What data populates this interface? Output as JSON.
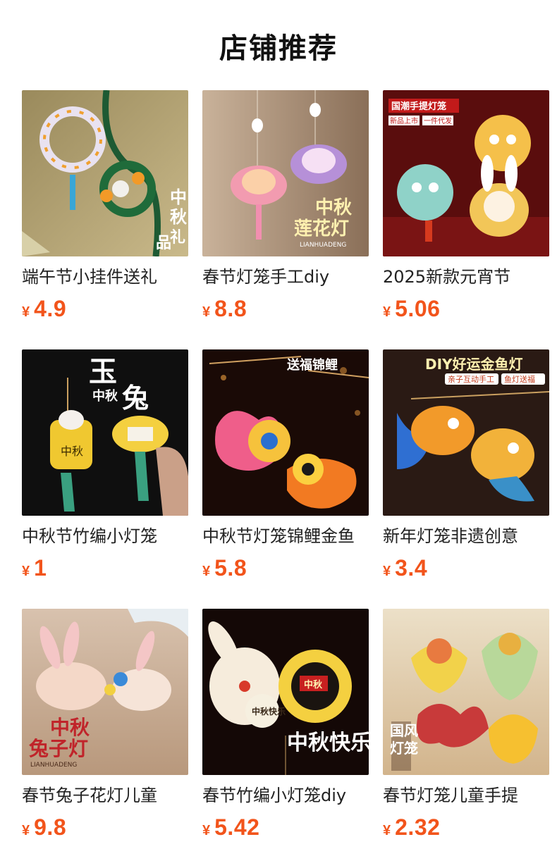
{
  "header": {
    "title": "店铺推荐"
  },
  "currency_symbol": "¥",
  "products": [
    {
      "name": "端午节小挂件送礼",
      "price": "4.9",
      "image_text": [
        "中秋礼品"
      ]
    },
    {
      "name": "春节灯笼手工diy",
      "price": "8.8",
      "image_text": [
        "中秋",
        "莲花灯",
        "LIANHUADENG"
      ]
    },
    {
      "name": "2025新款元宵节",
      "price": "5.06",
      "image_text": [
        "国潮手提灯笼",
        "新品上市",
        "一件代发"
      ]
    },
    {
      "name": "中秋节竹编小灯笼",
      "price": "1",
      "image_text": [
        "玉",
        "中秋",
        "兔"
      ]
    },
    {
      "name": "中秋节灯笼锦鲤金鱼",
      "price": "5.8",
      "image_text": [
        "送福锦鲤"
      ]
    },
    {
      "name": "新年灯笼非遗创意",
      "price": "3.4",
      "image_text": [
        "DIY好运金鱼灯",
        "亲子互动手工",
        "鱼灯送福"
      ]
    },
    {
      "name": "春节兔子花灯儿童",
      "price": "9.8",
      "image_text": [
        "中秋",
        "兔子灯",
        "LIANHUADENG"
      ]
    },
    {
      "name": "春节竹编小灯笼diy",
      "price": "5.42",
      "image_text": [
        "中秋快乐"
      ]
    },
    {
      "name": "春节灯笼儿童手提",
      "price": "2.32",
      "image_text": [
        "国风灯笼"
      ]
    }
  ]
}
